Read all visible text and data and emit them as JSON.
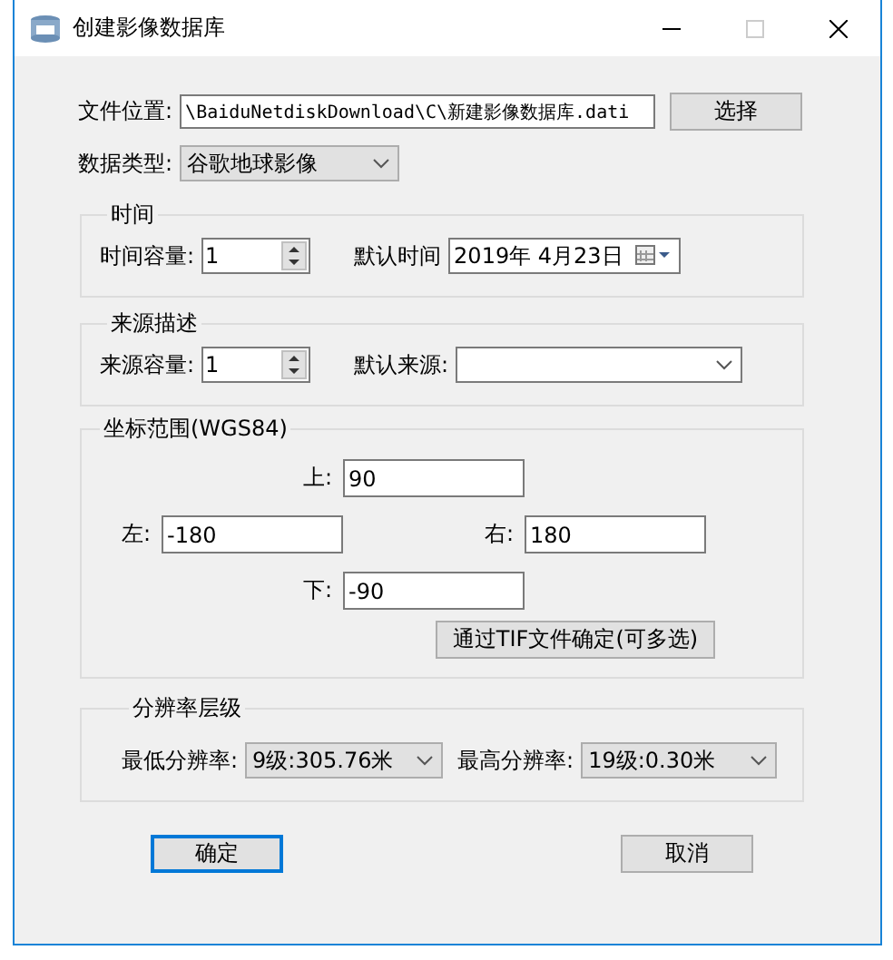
{
  "window": {
    "title": "创建影像数据库"
  },
  "file_location": {
    "label": "文件位置:",
    "value": "\\BaiduNetdiskDownload\\C\\新建影像数据库.dati",
    "button": "选择"
  },
  "data_type": {
    "label": "数据类型:",
    "value": "谷歌地球影像"
  },
  "time_group": {
    "title": "时间",
    "capacity_label": "时间容量:",
    "capacity_value": "1",
    "default_label": "默认时间",
    "default_value": "2019年 4月23日"
  },
  "source_group": {
    "title": "来源描述",
    "capacity_label": "来源容量:",
    "capacity_value": "1",
    "default_label": "默认来源:"
  },
  "coords_group": {
    "title": "坐标范围(WGS84)",
    "fields": [
      {
        "kind": "top",
        "label": "上:",
        "value": "90"
      },
      {
        "kind": "left",
        "label": "左:",
        "value": "-180"
      },
      {
        "kind": "right",
        "label": "右:",
        "value": "180"
      },
      {
        "kind": "bottom",
        "label": "下:",
        "value": "-90"
      }
    ],
    "button": "通过TIF文件确定(可多选)"
  },
  "resolution_group": {
    "title": "分辨率层级",
    "min_label": "最低分辨率:",
    "min_value": "9级:305.76米",
    "max_label": "最高分辨率:",
    "max_value": "19级:0.30米"
  },
  "buttons": [
    {
      "label": "确定",
      "selected": true
    },
    {
      "label": "取消",
      "selected": false
    }
  ]
}
